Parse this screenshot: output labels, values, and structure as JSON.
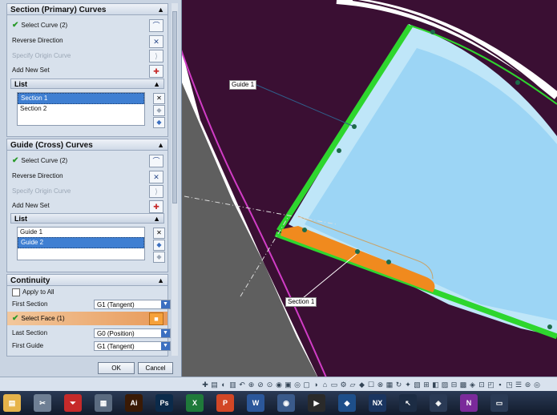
{
  "viewport": {
    "label_guide": "Guide 1",
    "label_section": "Section 1",
    "colors": {
      "background": "#3a0f33",
      "surface_light": "#c8ecfb",
      "surface_blue": "#7fc6f2",
      "green_edge": "#2ed62e",
      "orange_face": "#f08a1e",
      "gray_region": "#5a5a5a",
      "magenta_curve": "#d13cc6"
    }
  },
  "panel": {
    "section": {
      "title": "Section (Primary) Curves",
      "select_curve": "Select Curve (2)",
      "reverse_direction": "Reverse Direction",
      "specify_origin": "Specify Origin Curve",
      "add_new_set": "Add New Set",
      "list_title": "List",
      "items": [
        "Section 1",
        "Section 2"
      ]
    },
    "guide": {
      "title": "Guide (Cross) Curves",
      "select_curve": "Select Curve (2)",
      "reverse_direction": "Reverse Direction",
      "specify_origin": "Specify Origin Curve",
      "add_new_set": "Add New Set",
      "list_title": "List",
      "items": [
        "Guide 1",
        "Guide 2"
      ]
    },
    "continuity": {
      "title": "Continuity",
      "apply_all": "Apply to All",
      "first_section_label": "First Section",
      "first_section_value": "G1 (Tangent)",
      "select_face": "Select Face (1)",
      "last_section_label": "Last Section",
      "last_section_value": "G0 (Position)",
      "first_guide_label": "First Guide",
      "first_guide_value": "G1 (Tangent)"
    },
    "ok": "OK",
    "cancel": "Cancel"
  },
  "taskbar": {
    "apps": [
      {
        "name": "explorer",
        "text": "▤",
        "color": "#e6b34a"
      },
      {
        "name": "tools",
        "text": "✂",
        "color": "#6f7f94"
      },
      {
        "name": "acrobat",
        "text": "⏷",
        "color": "#c62a2a"
      },
      {
        "name": "calculator",
        "text": "▦",
        "color": "#5b6b80"
      },
      {
        "name": "illustrator",
        "text": "Ai",
        "color": "#3a1a05"
      },
      {
        "name": "photoshop",
        "text": "Ps",
        "color": "#0b2a4a"
      },
      {
        "name": "excel",
        "text": "X",
        "color": "#1f7a3a"
      },
      {
        "name": "powerpoint",
        "text": "P",
        "color": "#d24726"
      },
      {
        "name": "word",
        "text": "W",
        "color": "#2b579a"
      },
      {
        "name": "chrome",
        "text": "◉",
        "color": "#3a5a8a"
      },
      {
        "name": "media",
        "text": "▶",
        "color": "#2a2a2a"
      },
      {
        "name": "app",
        "text": "◆",
        "color": "#1e4f8a"
      },
      {
        "name": "nx",
        "text": "NX",
        "color": "#1a3560"
      },
      {
        "name": "cursor",
        "text": "↖",
        "color": "#1c2c44"
      },
      {
        "name": "app2",
        "text": "◈",
        "color": "#2a3a55"
      },
      {
        "name": "onenote",
        "text": "N",
        "color": "#7a2a9a"
      },
      {
        "name": "desktop",
        "text": "▭",
        "color": "#2a3a55"
      }
    ]
  }
}
